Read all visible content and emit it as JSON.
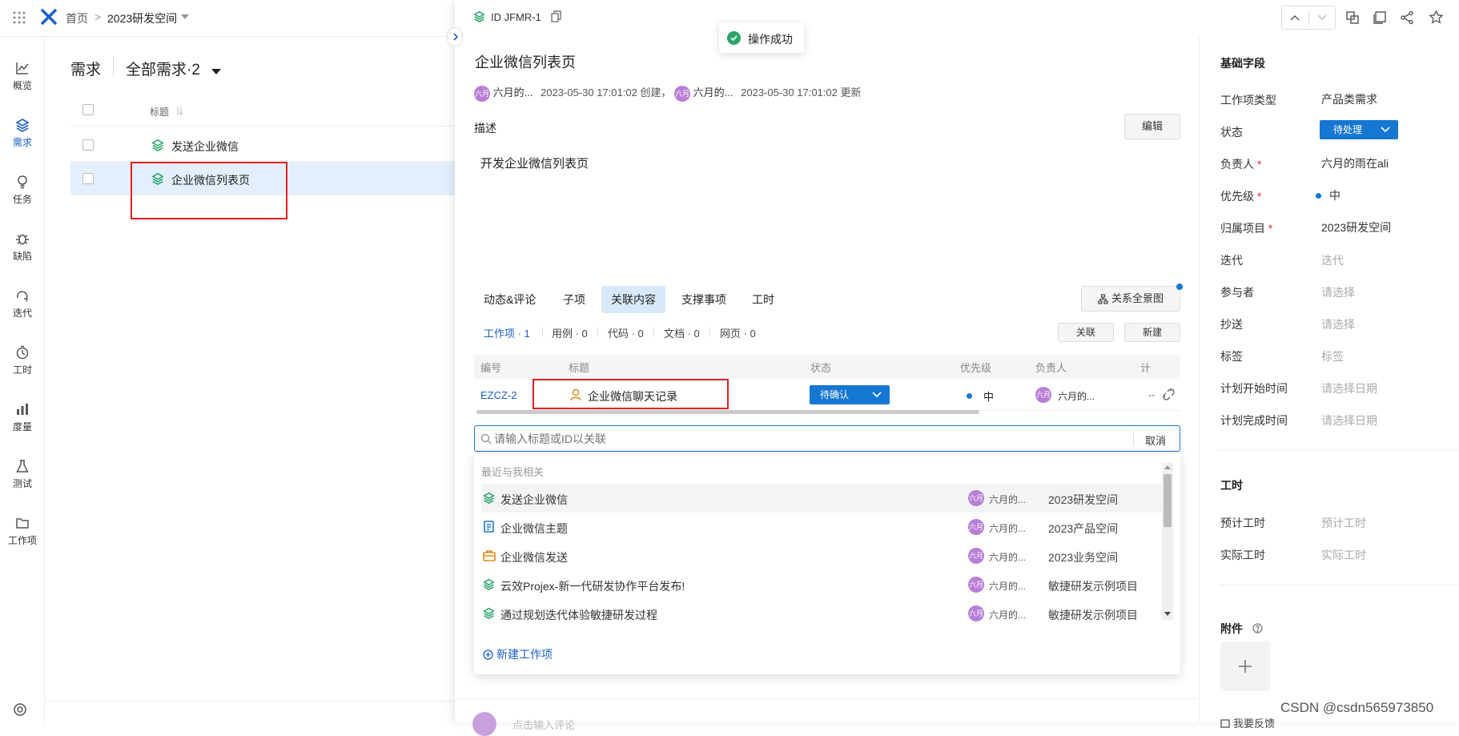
{
  "topbar": {
    "home": "首页",
    "sep": ">",
    "space": "2023研发空间"
  },
  "nav": [
    {
      "label": "概览",
      "icon": "chart-icon"
    },
    {
      "label": "需求",
      "icon": "layers-icon"
    },
    {
      "label": "任务",
      "icon": "bulb-icon"
    },
    {
      "label": "缺陷",
      "icon": "bug-icon"
    },
    {
      "label": "迭代",
      "icon": "cycle-icon"
    },
    {
      "label": "工时",
      "icon": "clock-icon"
    },
    {
      "label": "度量",
      "icon": "bars-icon"
    },
    {
      "label": "测试",
      "icon": "flask-icon"
    },
    {
      "label": "工作项",
      "icon": "folder-icon"
    }
  ],
  "list": {
    "title": "需求",
    "filter": "全部需求·2",
    "col_title": "标题",
    "rows": [
      {
        "title": "发送企业微信"
      },
      {
        "title": "企业微信列表页"
      }
    ]
  },
  "toast": {
    "text": "操作成功"
  },
  "drawer": {
    "id": "ID JFMR-1",
    "title": "企业微信列表页",
    "meta": {
      "creator": "六月的...",
      "created": "2023-05-30 17:01:02 创建，",
      "updater": "六月的...",
      "updated": "2023-05-30 17:01:02 更新"
    },
    "desc_label": "描述",
    "edit": "编辑",
    "desc_text": "开发企业微信列表页",
    "tabs": [
      "动态&评论",
      "子项",
      "关联内容",
      "支撑事项",
      "工时"
    ],
    "graph_button": "关系全景图",
    "subtabs": [
      "工作项 · 1",
      "用例 · 0",
      "代码 · 0",
      "文档 · 0",
      "网页 · 0"
    ],
    "link_btn": "关联",
    "new_btn": "新建",
    "table": {
      "headers": [
        "编号",
        "标题",
        "状态",
        "优先级",
        "负责人",
        "计"
      ],
      "row": {
        "id": "EZCZ-2",
        "title": "企业微信聊天记录",
        "status": "待确认",
        "priority": "中",
        "owner": "六月的...",
        "last": "--"
      }
    },
    "search": {
      "placeholder": "请输入标题或ID以关联",
      "cancel": "取消"
    },
    "dropdown": {
      "section": "最近与我相关",
      "items": [
        {
          "title": "发送企业微信",
          "owner": "六月的...",
          "project": "2023研发空间",
          "icon": "layers-icon"
        },
        {
          "title": "企业微信主题",
          "owner": "六月的...",
          "project": "2023产品空间",
          "icon": "doc-icon"
        },
        {
          "title": "企业微信发送",
          "owner": "六月的...",
          "project": "2023业务空间",
          "icon": "briefcase-icon"
        },
        {
          "title": "云效Projex-新一代研发协作平台发布!",
          "owner": "六月的...",
          "project": "敏捷研发示例项目",
          "icon": "layers-icon"
        },
        {
          "title": "通过规划迭代体验敏捷研发过程",
          "owner": "六月的...",
          "project": "敏捷研发示例项目",
          "icon": "layers-icon"
        }
      ],
      "new_item": "新建工作项"
    },
    "bottom_placeholder": "点击输入评论"
  },
  "panel": {
    "basic": "基础字段",
    "fields": [
      {
        "label": "工作项类型",
        "value": "产品类需求",
        "req": false,
        "ph": false
      },
      {
        "label": "状态",
        "value": "待处理",
        "req": false,
        "ph": false
      },
      {
        "label": "负责人",
        "value": "六月的雨在ali",
        "req": true,
        "ph": false
      },
      {
        "label": "优先级",
        "value": "中",
        "req": true,
        "ph": false
      },
      {
        "label": "归属项目",
        "value": "2023研发空间",
        "req": true,
        "ph": false
      },
      {
        "label": "迭代",
        "value": "迭代",
        "req": false,
        "ph": true
      },
      {
        "label": "参与者",
        "value": "请选择",
        "req": false,
        "ph": true
      },
      {
        "label": "抄送",
        "value": "请选择",
        "req": false,
        "ph": true
      },
      {
        "label": "标签",
        "value": "标签",
        "req": false,
        "ph": true
      },
      {
        "label": "计划开始时间",
        "value": "请选择日期",
        "req": false,
        "ph": true
      },
      {
        "label": "计划完成时间",
        "value": "请选择日期",
        "req": false,
        "ph": true
      }
    ],
    "worktime": "工时",
    "wfields": [
      {
        "label": "预计工时",
        "value": "预计工时"
      },
      {
        "label": "实际工时",
        "value": "实际工时"
      }
    ],
    "attach": "附件",
    "feedback": "我要反馈"
  },
  "watermark": "CSDN @csdn565973850",
  "colors": {
    "primary": "#1b5ec8",
    "status_blue": "#1677d2",
    "highlight": "#e02020",
    "green": "#2aa56a"
  }
}
